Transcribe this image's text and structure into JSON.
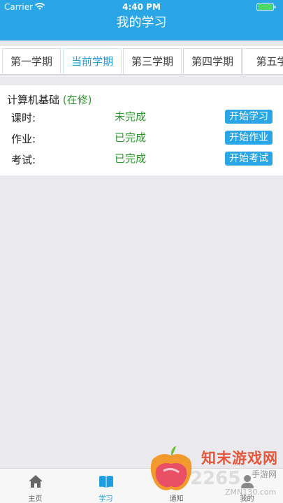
{
  "status_bar": {
    "carrier": "Carrier",
    "time": "4:40 PM"
  },
  "nav": {
    "title": "我的学习"
  },
  "tabs": [
    {
      "label": "第一学期",
      "active": false
    },
    {
      "label": "当前学期",
      "active": true
    },
    {
      "label": "第三学期",
      "active": false
    },
    {
      "label": "第四学期",
      "active": false
    },
    {
      "label": "第五学",
      "active": false
    }
  ],
  "course": {
    "name": "计算机基础",
    "status": "(在修)",
    "rows": [
      {
        "label": "课时:",
        "value": "未完成",
        "button": "开始学习"
      },
      {
        "label": "作业:",
        "value": "已完成",
        "button": "开始作业"
      },
      {
        "label": "考试:",
        "value": "已完成",
        "button": "开始考试"
      }
    ]
  },
  "tabbar": [
    {
      "label": "主页",
      "icon": "home-icon",
      "active": false
    },
    {
      "label": "学习",
      "icon": "book-icon",
      "active": true
    },
    {
      "label": "通知",
      "icon": "bell-icon",
      "active": false
    },
    {
      "label": "我的",
      "icon": "person-icon",
      "active": false
    }
  ],
  "watermark": {
    "brand": "知末游戏网",
    "number": "2265",
    "sub": "手游网",
    "url": "ZMN130.com"
  },
  "colors": {
    "primary": "#2aa5e6",
    "success": "#2c9a2c",
    "background": "#eaeaee"
  }
}
